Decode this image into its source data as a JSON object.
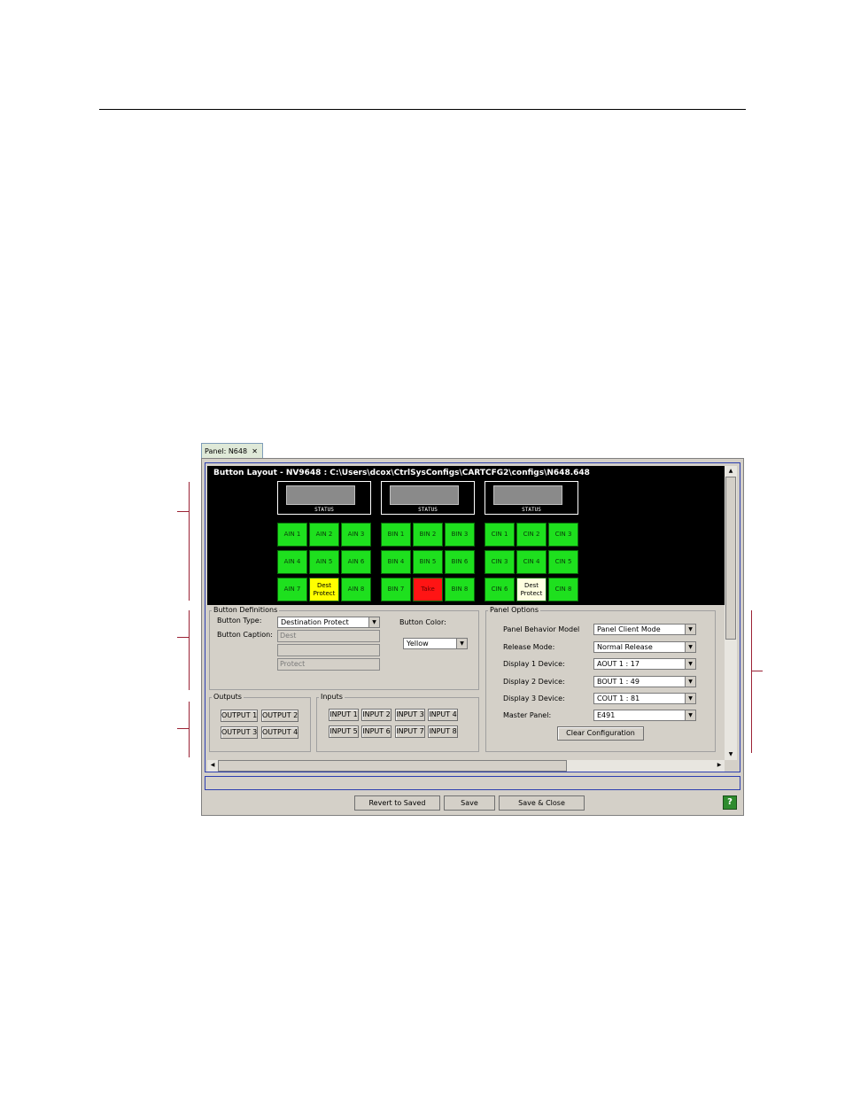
{
  "tab": {
    "label": "Panel: N648"
  },
  "layout": {
    "title": "Button Layout - NV9648 : C:\\Users\\dcox\\CtrlSysConfigs\\CARTCFG2\\configs\\N648.648",
    "status_label": "STATUS",
    "groups": [
      {
        "buttons": [
          "AIN 1",
          "AIN 2",
          "AIN 3",
          "AIN 4",
          "AIN 5",
          "AIN 6",
          "AIN 7",
          "Dest Protect",
          "AIN 8"
        ]
      },
      {
        "buttons": [
          "BIN 1",
          "BIN 2",
          "BIN 3",
          "BIN 4",
          "BIN 5",
          "BIN 6",
          "BIN 7",
          "Take",
          "BIN 8"
        ]
      },
      {
        "buttons": [
          "CIN 1",
          "CIN 2",
          "CIN 3",
          "CIN 3",
          "CIN 4",
          "CIN 5",
          "CIN 6",
          "Dest Protect",
          "CIN 8"
        ]
      }
    ],
    "colors": {
      "green": "#1ee01e",
      "yellow": "#ffff00",
      "red": "#ff1414",
      "cream": "#ffffe0"
    }
  },
  "button_definitions": {
    "legend": "Button Definitions",
    "type_label": "Button Type:",
    "type_value": "Destination Protect",
    "caption_label": "Button Caption:",
    "caption_lines": [
      "Dest",
      "",
      "Protect"
    ],
    "color_label": "Button Color:",
    "color_value": "Yellow"
  },
  "outputs": {
    "legend": "Outputs",
    "buttons": [
      "OUTPUT 1",
      "OUTPUT 2",
      "OUTPUT 3",
      "OUTPUT 4"
    ]
  },
  "inputs": {
    "legend": "Inputs",
    "buttons": [
      "INPUT 1",
      "INPUT 2",
      "INPUT 3",
      "INPUT 4",
      "INPUT 5",
      "INPUT 6",
      "INPUT 7",
      "INPUT 8"
    ]
  },
  "panel_options": {
    "legend": "Panel Options",
    "rows": [
      {
        "label": "Panel Behavior Model",
        "value": "Panel Client Mode"
      },
      {
        "label": "Release Mode:",
        "value": "Normal Release"
      },
      {
        "label": "Display 1 Device:",
        "value": "AOUT  1 : 17"
      },
      {
        "label": "Display 2 Device:",
        "value": "BOUT  1 : 49"
      },
      {
        "label": "Display 3 Device:",
        "value": "COUT  1 : 81"
      },
      {
        "label": "Master Panel:",
        "value": "E491"
      }
    ],
    "clear_button": "Clear Configuration"
  },
  "footer": {
    "revert": "Revert to Saved",
    "save": "Save",
    "save_close": "Save & Close",
    "help": "?"
  }
}
